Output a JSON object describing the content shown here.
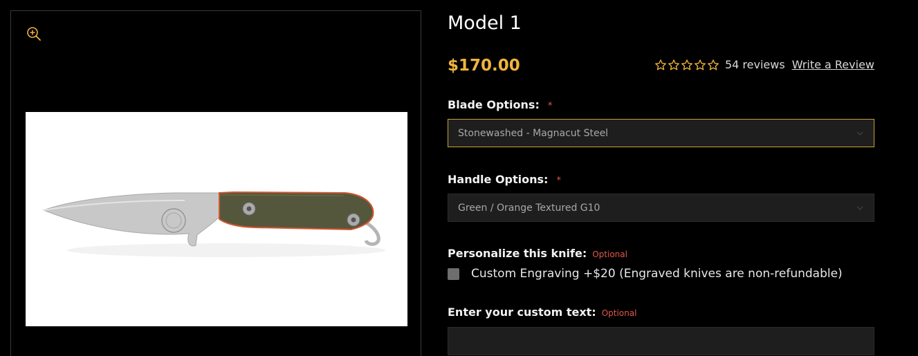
{
  "gallery": {
    "zoom_icon": "zoom-in-icon",
    "image_alt": "knife-product-photo"
  },
  "product": {
    "title": "Model 1",
    "price": "$170.00",
    "rating": {
      "stars": 5,
      "review_count_text": "54 reviews",
      "write_review_label": "Write a Review"
    }
  },
  "options": {
    "blade": {
      "label": "Blade Options:",
      "required_marker": "*",
      "selected": "Stonewashed - Magnacut Steel"
    },
    "handle": {
      "label": "Handle Options:",
      "required_marker": "*",
      "selected": "Green / Orange Textured G10"
    },
    "personalize": {
      "label": "Personalize this knife:",
      "optional_text": "Optional",
      "checkbox_label": "Custom Engraving +$20 (Engraved knives are non-refundable)"
    },
    "custom_text": {
      "label": "Enter your custom text:",
      "optional_text": "Optional",
      "value": ""
    }
  },
  "colors": {
    "accent": "#f0b43c",
    "required": "#e2574c",
    "background": "#000000",
    "field": "#1e1e1e"
  }
}
